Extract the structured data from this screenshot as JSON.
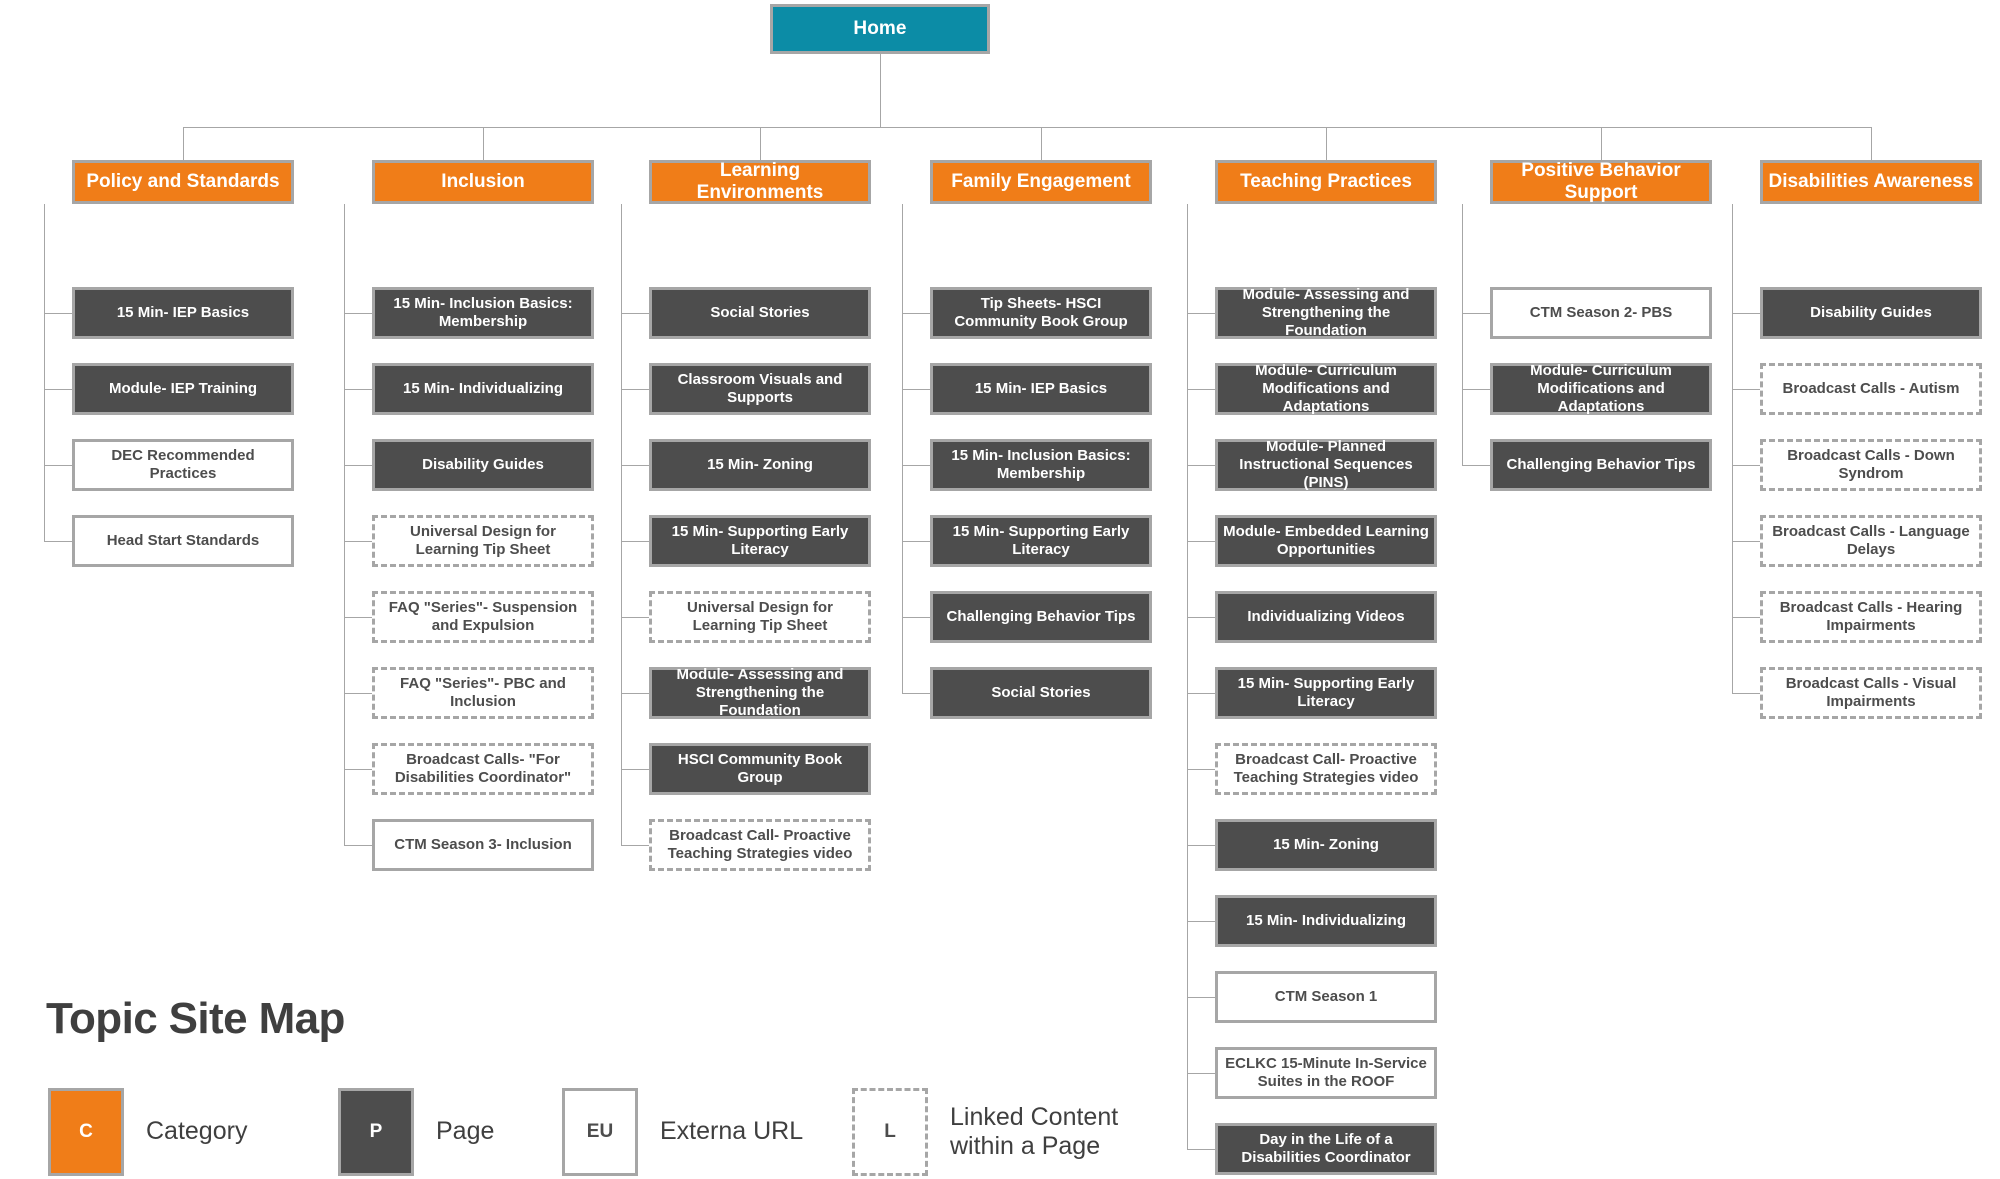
{
  "title": "Topic Site Map",
  "colors": {
    "home": "#0c8ca6",
    "category": "#f07d18",
    "page": "#4d4d4d",
    "external_url": "#ffffff",
    "border": "#a6a6a6",
    "text_dark": "#3f3f3f"
  },
  "root": {
    "label": "Home",
    "type": "home"
  },
  "columns": [
    {
      "header": "Policy and Standards",
      "items": [
        {
          "label": "15 Min- IEP Basics",
          "type": "page"
        },
        {
          "label": "Module- IEP Training",
          "type": "page"
        },
        {
          "label": "DEC Recommended Practices",
          "type": "eu"
        },
        {
          "label": "Head Start Standards",
          "type": "eu"
        }
      ]
    },
    {
      "header": "Inclusion",
      "items": [
        {
          "label": "15 Min- Inclusion Basics: Membership",
          "type": "page"
        },
        {
          "label": "15 Min- Individualizing",
          "type": "page"
        },
        {
          "label": "Disability Guides",
          "type": "page"
        },
        {
          "label": "Universal Design for Learning Tip Sheet",
          "type": "linked"
        },
        {
          "label": "FAQ \"Series\"- Suspension and Expulsion",
          "type": "linked"
        },
        {
          "label": "FAQ \"Series\"- PBC and Inclusion",
          "type": "linked"
        },
        {
          "label": "Broadcast Calls- \"For Disabilities Coordinator\"",
          "type": "linked"
        },
        {
          "label": "CTM Season 3- Inclusion",
          "type": "eu"
        }
      ]
    },
    {
      "header": "Learning Environments",
      "items": [
        {
          "label": "Social Stories",
          "type": "page"
        },
        {
          "label": "Classroom Visuals and Supports",
          "type": "page"
        },
        {
          "label": "15 Min- Zoning",
          "type": "page"
        },
        {
          "label": "15 Min- Supporting Early Literacy",
          "type": "page"
        },
        {
          "label": "Universal Design for Learning Tip Sheet",
          "type": "linked"
        },
        {
          "label": "Module- Assessing and Strengthening the Foundation",
          "type": "page"
        },
        {
          "label": "HSCI Community Book Group",
          "type": "page"
        },
        {
          "label": "Broadcast Call- Proactive Teaching Strategies video",
          "type": "linked"
        }
      ]
    },
    {
      "header": "Family Engagement",
      "items": [
        {
          "label": "Tip Sheets- HSCI Community Book Group",
          "type": "page"
        },
        {
          "label": "15 Min- IEP Basics",
          "type": "page"
        },
        {
          "label": "15 Min- Inclusion Basics: Membership",
          "type": "page"
        },
        {
          "label": "15 Min- Supporting Early Literacy",
          "type": "page"
        },
        {
          "label": "Challenging Behavior Tips",
          "type": "page"
        },
        {
          "label": "Social Stories",
          "type": "page"
        }
      ]
    },
    {
      "header": "Teaching Practices",
      "items": [
        {
          "label": "Module- Assessing and Strengthening the Foundation",
          "type": "page"
        },
        {
          "label": "Module- Curriculum Modifications and Adaptations",
          "type": "page"
        },
        {
          "label": "Module- Planned Instructional Sequences (PINS)",
          "type": "page"
        },
        {
          "label": "Module- Embedded Learning Opportunities",
          "type": "page"
        },
        {
          "label": "Individualizing Videos",
          "type": "page"
        },
        {
          "label": "15 Min- Supporting Early Literacy",
          "type": "page"
        },
        {
          "label": "Broadcast Call- Proactive Teaching Strategies video",
          "type": "linked"
        },
        {
          "label": "15 Min- Zoning",
          "type": "page"
        },
        {
          "label": "15 Min- Individualizing",
          "type": "page"
        },
        {
          "label": "CTM Season 1",
          "type": "eu"
        },
        {
          "label": "ECLKC 15-Minute In-Service Suites in the ROOF",
          "type": "eu"
        },
        {
          "label": "Day in the Life of a Disabilities Coordinator",
          "type": "page"
        }
      ]
    },
    {
      "header": "Positive Behavior Support",
      "items": [
        {
          "label": "CTM Season 2- PBS",
          "type": "eu"
        },
        {
          "label": "Module- Curriculum Modifications and Adaptations",
          "type": "page"
        },
        {
          "label": "Challenging Behavior Tips",
          "type": "page"
        }
      ]
    },
    {
      "header": "Disabilities Awareness",
      "items": [
        {
          "label": "Disability Guides",
          "type": "page"
        },
        {
          "label": "Broadcast Calls - Autism",
          "type": "linked"
        },
        {
          "label": "Broadcast Calls - Down Syndrom",
          "type": "linked"
        },
        {
          "label": "Broadcast Calls - Language Delays",
          "type": "linked"
        },
        {
          "label": "Broadcast Calls - Hearing Impairments",
          "type": "linked"
        },
        {
          "label": "Broadcast Calls - Visual Impairments",
          "type": "linked"
        }
      ]
    }
  ],
  "legend": [
    {
      "key": "C",
      "label": "Category",
      "type": "category"
    },
    {
      "key": "P",
      "label": "Page",
      "type": "page"
    },
    {
      "key": "EU",
      "label": "Externa URL",
      "type": "eu"
    },
    {
      "key": "L",
      "label": "Linked Content\nwithin a Page",
      "type": "linked"
    }
  ]
}
